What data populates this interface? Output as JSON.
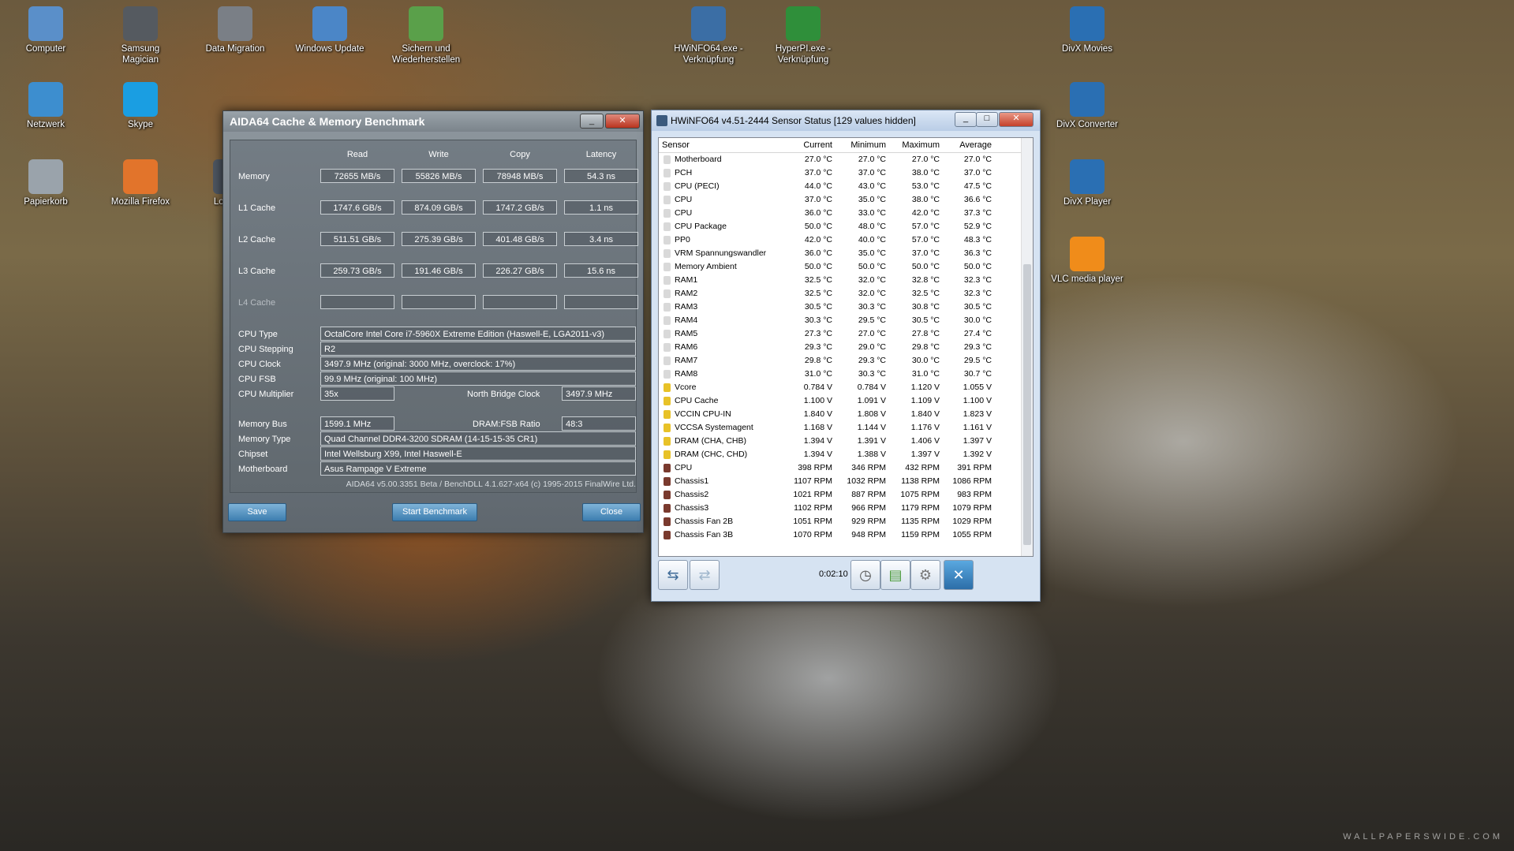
{
  "desktop": {
    "icons": [
      {
        "label": "Computer",
        "color": "#5a8fc9"
      },
      {
        "label": "Samsung Magician",
        "color": "#555a60"
      },
      {
        "label": "Data Migration",
        "color": "#7a7f86"
      },
      {
        "label": "Windows Update",
        "color": "#4b86c7"
      },
      {
        "label": "Sichern und Wiederherstellen",
        "color": "#5aa04a"
      },
      {
        "label": "HWiNFO64.exe - Verknüpfung",
        "color": "#3b6ea5"
      },
      {
        "label": "HyperPI.exe - Verknüpfung",
        "color": "#2f8f3a"
      },
      {
        "label": "DivX Movies",
        "color": "#2a6fb3"
      },
      {
        "label": "Netzwerk",
        "color": "#3d8ecf"
      },
      {
        "label": "Skype",
        "color": "#1a9ee2"
      },
      {
        "label": "DivX Converter",
        "color": "#2a6fb3"
      },
      {
        "label": "Papierkorb",
        "color": "#9aa3ab"
      },
      {
        "label": "Mozilla Firefox",
        "color": "#e2742b"
      },
      {
        "label": "Logite S",
        "color": "#4d5560"
      },
      {
        "label": "DivX Player",
        "color": "#2a6fb3"
      },
      {
        "label": "VLC media player",
        "color": "#f08c1a"
      }
    ],
    "watermark": "WALLPAPERSWIDE.COM"
  },
  "aida": {
    "title": "AIDA64 Cache & Memory Benchmark",
    "col_headers": [
      "Read",
      "Write",
      "Copy",
      "Latency"
    ],
    "rows": [
      {
        "label": "Memory",
        "values": [
          "72655 MB/s",
          "55826 MB/s",
          "78948 MB/s",
          "54.3 ns"
        ]
      },
      {
        "label": "L1 Cache",
        "values": [
          "1747.6 GB/s",
          "874.09 GB/s",
          "1747.2 GB/s",
          "1.1 ns"
        ]
      },
      {
        "label": "L2 Cache",
        "values": [
          "511.51 GB/s",
          "275.39 GB/s",
          "401.48 GB/s",
          "3.4 ns"
        ]
      },
      {
        "label": "L3 Cache",
        "values": [
          "259.73 GB/s",
          "191.46 GB/s",
          "226.27 GB/s",
          "15.6 ns"
        ]
      },
      {
        "label": "L4 Cache",
        "values": [
          "",
          "",
          "",
          ""
        ]
      }
    ],
    "cpu_type_label": "CPU Type",
    "cpu_type": "OctalCore Intel Core i7-5960X Extreme Edition  (Haswell-E, LGA2011-v3)",
    "cpu_stepping_label": "CPU Stepping",
    "cpu_stepping": "R2",
    "cpu_clock_label": "CPU Clock",
    "cpu_clock": "3497.9 MHz  (original: 3000 MHz, overclock: 17%)",
    "cpu_fsb_label": "CPU FSB",
    "cpu_fsb": "99.9 MHz  (original: 100 MHz)",
    "cpu_mult_label": "CPU Multiplier",
    "cpu_mult": "35x",
    "nb_clock_label": "North Bridge Clock",
    "nb_clock": "3497.9 MHz",
    "mem_bus_label": "Memory Bus",
    "mem_bus": "1599.1 MHz",
    "dram_ratio_label": "DRAM:FSB Ratio",
    "dram_ratio": "48:3",
    "mem_type_label": "Memory Type",
    "mem_type": "Quad Channel DDR4-3200 SDRAM  (14-15-15-35 CR1)",
    "chipset_label": "Chipset",
    "chipset": "Intel Wellsburg X99, Intel Haswell-E",
    "mobo_label": "Motherboard",
    "mobo": "Asus Rampage V Extreme",
    "footer": "AIDA64 v5.00.3351 Beta / BenchDLL 4.1.627-x64  (c) 1995-2015 FinalWire Ltd.",
    "save": "Save",
    "start": "Start Benchmark",
    "close": "Close"
  },
  "hwinfo": {
    "title": "HWiNFO64 v4.51-2444 Sensor Status [129 values hidden]",
    "headers": [
      "Sensor",
      "Current",
      "Minimum",
      "Maximum",
      "Average"
    ],
    "rows": [
      {
        "name": "Motherboard",
        "type": "temp",
        "v": [
          "27.0 °C",
          "27.0 °C",
          "27.0 °C",
          "27.0 °C"
        ]
      },
      {
        "name": "PCH",
        "type": "temp",
        "v": [
          "37.0 °C",
          "37.0 °C",
          "38.0 °C",
          "37.0 °C"
        ]
      },
      {
        "name": "CPU (PECI)",
        "type": "temp",
        "v": [
          "44.0 °C",
          "43.0 °C",
          "53.0 °C",
          "47.5 °C"
        ]
      },
      {
        "name": "CPU",
        "type": "temp",
        "v": [
          "37.0 °C",
          "35.0 °C",
          "38.0 °C",
          "36.6 °C"
        ]
      },
      {
        "name": "CPU",
        "type": "temp",
        "v": [
          "36.0 °C",
          "33.0 °C",
          "42.0 °C",
          "37.3 °C"
        ]
      },
      {
        "name": "CPU Package",
        "type": "temp",
        "v": [
          "50.0 °C",
          "48.0 °C",
          "57.0 °C",
          "52.9 °C"
        ]
      },
      {
        "name": "PP0",
        "type": "temp",
        "v": [
          "42.0 °C",
          "40.0 °C",
          "57.0 °C",
          "48.3 °C"
        ]
      },
      {
        "name": "VRM Spannungswandler",
        "type": "temp",
        "v": [
          "36.0 °C",
          "35.0 °C",
          "37.0 °C",
          "36.3 °C"
        ]
      },
      {
        "name": "Memory Ambient",
        "type": "temp",
        "v": [
          "50.0 °C",
          "50.0 °C",
          "50.0 °C",
          "50.0 °C"
        ]
      },
      {
        "name": "RAM1",
        "type": "temp",
        "v": [
          "32.5 °C",
          "32.0 °C",
          "32.8 °C",
          "32.3 °C"
        ]
      },
      {
        "name": "RAM2",
        "type": "temp",
        "v": [
          "32.5 °C",
          "32.0 °C",
          "32.5 °C",
          "32.3 °C"
        ]
      },
      {
        "name": "RAM3",
        "type": "temp",
        "v": [
          "30.5 °C",
          "30.3 °C",
          "30.8 °C",
          "30.5 °C"
        ]
      },
      {
        "name": "RAM4",
        "type": "temp",
        "v": [
          "30.3 °C",
          "29.5 °C",
          "30.5 °C",
          "30.0 °C"
        ]
      },
      {
        "name": "RAM5",
        "type": "temp",
        "v": [
          "27.3 °C",
          "27.0 °C",
          "27.8 °C",
          "27.4 °C"
        ]
      },
      {
        "name": "RAM6",
        "type": "temp",
        "v": [
          "29.3 °C",
          "29.0 °C",
          "29.8 °C",
          "29.3 °C"
        ]
      },
      {
        "name": "RAM7",
        "type": "temp",
        "v": [
          "29.8 °C",
          "29.3 °C",
          "30.0 °C",
          "29.5 °C"
        ]
      },
      {
        "name": "RAM8",
        "type": "temp",
        "v": [
          "31.0 °C",
          "30.3 °C",
          "31.0 °C",
          "30.7 °C"
        ]
      },
      {
        "name": "Vcore",
        "type": "volt",
        "v": [
          "0.784 V",
          "0.784 V",
          "1.120 V",
          "1.055 V"
        ]
      },
      {
        "name": "CPU Cache",
        "type": "volt",
        "v": [
          "1.100 V",
          "1.091 V",
          "1.109 V",
          "1.100 V"
        ]
      },
      {
        "name": "VCCIN CPU-IN",
        "type": "volt",
        "v": [
          "1.840 V",
          "1.808 V",
          "1.840 V",
          "1.823 V"
        ]
      },
      {
        "name": "VCCSA Systemagent",
        "type": "volt",
        "v": [
          "1.168 V",
          "1.144 V",
          "1.176 V",
          "1.161 V"
        ]
      },
      {
        "name": "DRAM (CHA, CHB)",
        "type": "volt",
        "v": [
          "1.394 V",
          "1.391 V",
          "1.406 V",
          "1.397 V"
        ]
      },
      {
        "name": "DRAM (CHC, CHD)",
        "type": "volt",
        "v": [
          "1.394 V",
          "1.388 V",
          "1.397 V",
          "1.392 V"
        ]
      },
      {
        "name": "CPU",
        "type": "fan",
        "v": [
          "398 RPM",
          "346 RPM",
          "432 RPM",
          "391 RPM"
        ]
      },
      {
        "name": "Chassis1",
        "type": "fan",
        "v": [
          "1107 RPM",
          "1032 RPM",
          "1138 RPM",
          "1086 RPM"
        ]
      },
      {
        "name": "Chassis2",
        "type": "fan",
        "v": [
          "1021 RPM",
          "887 RPM",
          "1075 RPM",
          "983 RPM"
        ]
      },
      {
        "name": "Chassis3",
        "type": "fan",
        "v": [
          "1102 RPM",
          "966 RPM",
          "1179 RPM",
          "1079 RPM"
        ]
      },
      {
        "name": "Chassis Fan 2B",
        "type": "fan",
        "v": [
          "1051 RPM",
          "929 RPM",
          "1135 RPM",
          "1029 RPM"
        ]
      },
      {
        "name": "Chassis Fan 3B",
        "type": "fan",
        "v": [
          "1070 RPM",
          "948 RPM",
          "1159 RPM",
          "1055 RPM"
        ]
      }
    ],
    "elapsed": "0:02:10",
    "colors": {
      "temp": "#d9d9d9",
      "volt": "#e8c228",
      "fan": "#7a3a2e"
    }
  }
}
